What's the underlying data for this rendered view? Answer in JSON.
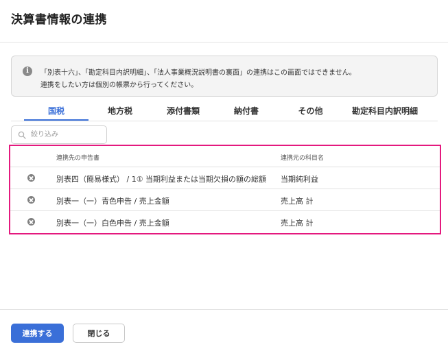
{
  "dialog": {
    "title": "決算書情報の連携"
  },
  "notice": {
    "icon": "info-icon",
    "line1": "「別表十六」、「勘定科目内訳明細」、「法人事業概況説明書の裏面」の連携はこの画面ではできません。",
    "line2": "連携をしたい方は個別の帳票から行ってください。"
  },
  "tabs": [
    {
      "label": "国税",
      "active": true
    },
    {
      "label": "地方税",
      "active": false
    },
    {
      "label": "添付書類",
      "active": false
    },
    {
      "label": "納付書",
      "active": false
    },
    {
      "label": "その他",
      "active": false
    },
    {
      "label": "勘定科目内訳明細",
      "active": false
    }
  ],
  "search": {
    "placeholder": "絞り込み",
    "value": ""
  },
  "table": {
    "headers": {
      "target": "連携先の申告書",
      "source": "連携元の科目名"
    },
    "rows": [
      {
        "target": "別表四（簡易様式） / 1① 当期利益または当期欠損の額の総額",
        "source": "当期純利益"
      },
      {
        "target": "別表一（一）青色申告 / 売上金額",
        "source": "売上高 計"
      },
      {
        "target": "別表一（一）白色申告 / 売上金額",
        "source": "売上高 計"
      }
    ]
  },
  "footer": {
    "primary_label": "連携する",
    "secondary_label": "閉じる"
  },
  "colors": {
    "accent": "#3a6fd8",
    "highlight_border": "#e4197e",
    "notice_bg": "#f4f4f4"
  }
}
